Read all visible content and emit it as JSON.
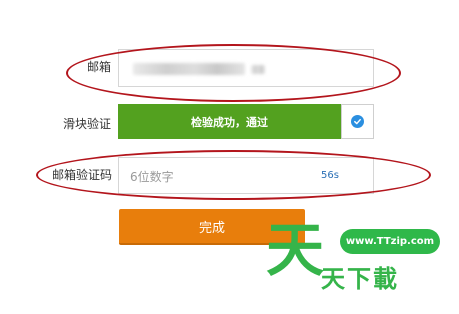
{
  "form": {
    "email_label": "邮箱",
    "slider_label": "滑块验证",
    "slider_status": "检验成功，通过",
    "code_label": "邮箱验证码",
    "code_placeholder": "6位数字",
    "countdown": "56s",
    "submit_label": "完成"
  },
  "watermark": {
    "url": "www.TTzip.com",
    "big_char": "天",
    "text": "天下載"
  },
  "colors": {
    "slider_success": "#53a11f",
    "submit_button": "#e87e0c",
    "countdown_text": "#2a6fb5",
    "annotation_oval": "#b3151c",
    "watermark_green": "#35b44a"
  },
  "icons": {
    "slider_handle": "check-icon"
  }
}
